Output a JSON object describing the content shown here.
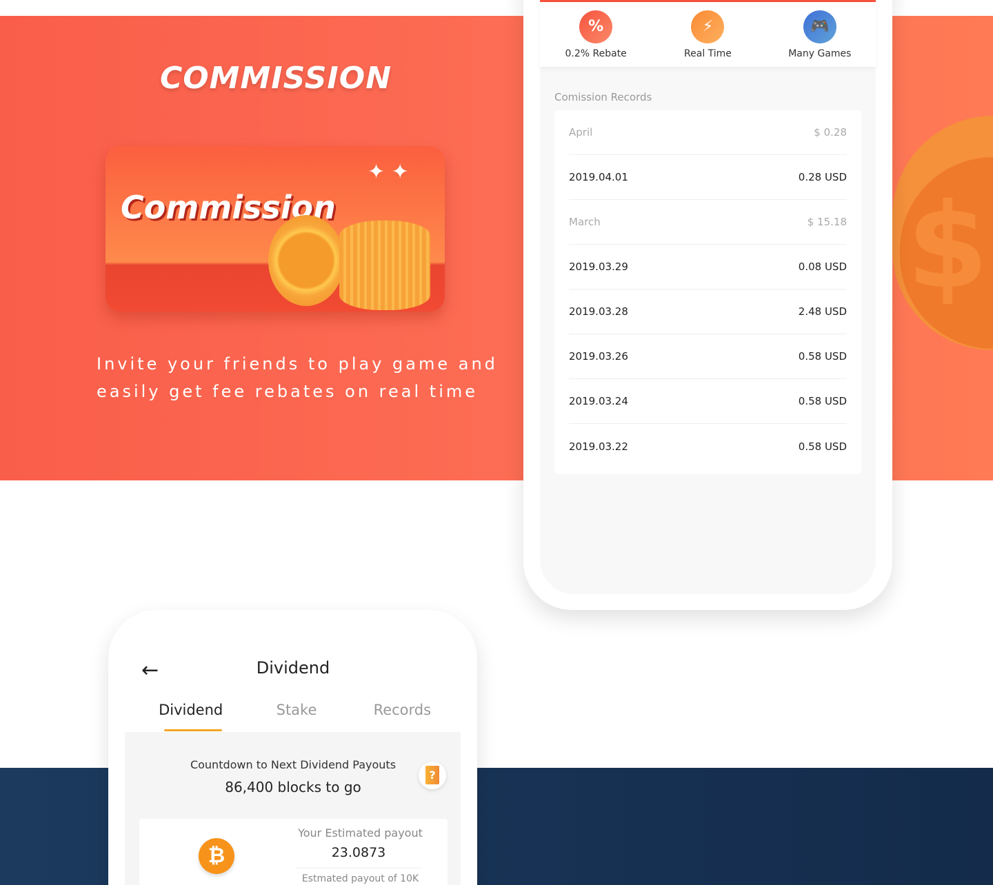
{
  "hero": {
    "title": "COMMISSION",
    "banner_text": "Commission",
    "tagline_1": "Invite your friends to play game and",
    "tagline_2": "easily get fee rebates on real time"
  },
  "features": [
    {
      "label": "0.2% Rebate",
      "icon": "rebate-tag-icon",
      "color": "#f5624a"
    },
    {
      "label": "Real Time",
      "icon": "lightning-icon",
      "color": "#fb9a3c"
    },
    {
      "label": "Many Games",
      "icon": "gamepad-icon",
      "color": "#4a7fd6"
    }
  ],
  "records": {
    "title": "Comission Records",
    "rows": [
      {
        "type": "month",
        "left": "April",
        "right": "$ 0.28"
      },
      {
        "type": "entry",
        "left": "2019.04.01",
        "right": "0.28 USD"
      },
      {
        "type": "month",
        "left": "March",
        "right": "$ 15.18"
      },
      {
        "type": "entry",
        "left": "2019.03.29",
        "right": "0.08 USD"
      },
      {
        "type": "entry",
        "left": "2019.03.28",
        "right": "2.48 USD"
      },
      {
        "type": "entry",
        "left": "2019.03.26",
        "right": "0.58 USD"
      },
      {
        "type": "entry",
        "left": "2019.03.24",
        "right": "0.58 USD"
      },
      {
        "type": "entry",
        "left": "2019.03.22",
        "right": "0.58 USD"
      }
    ]
  },
  "dividend": {
    "back": "←",
    "title": "Dividend",
    "tabs": [
      "Dividend",
      "Stake",
      "Records"
    ],
    "countdown_label": "Countdown to Next Dividend Payouts",
    "blocks": "86,400 blocks to go",
    "help": "?",
    "coin": "₿",
    "estimated_label": "Your Estimated payout",
    "estimated_value": "23.0873",
    "estimated_10k_label": "Estmated payout of 10K"
  },
  "colors": {
    "accent": "#f95e4a",
    "navy": "#173052",
    "tab_underline": "#f5a623"
  }
}
